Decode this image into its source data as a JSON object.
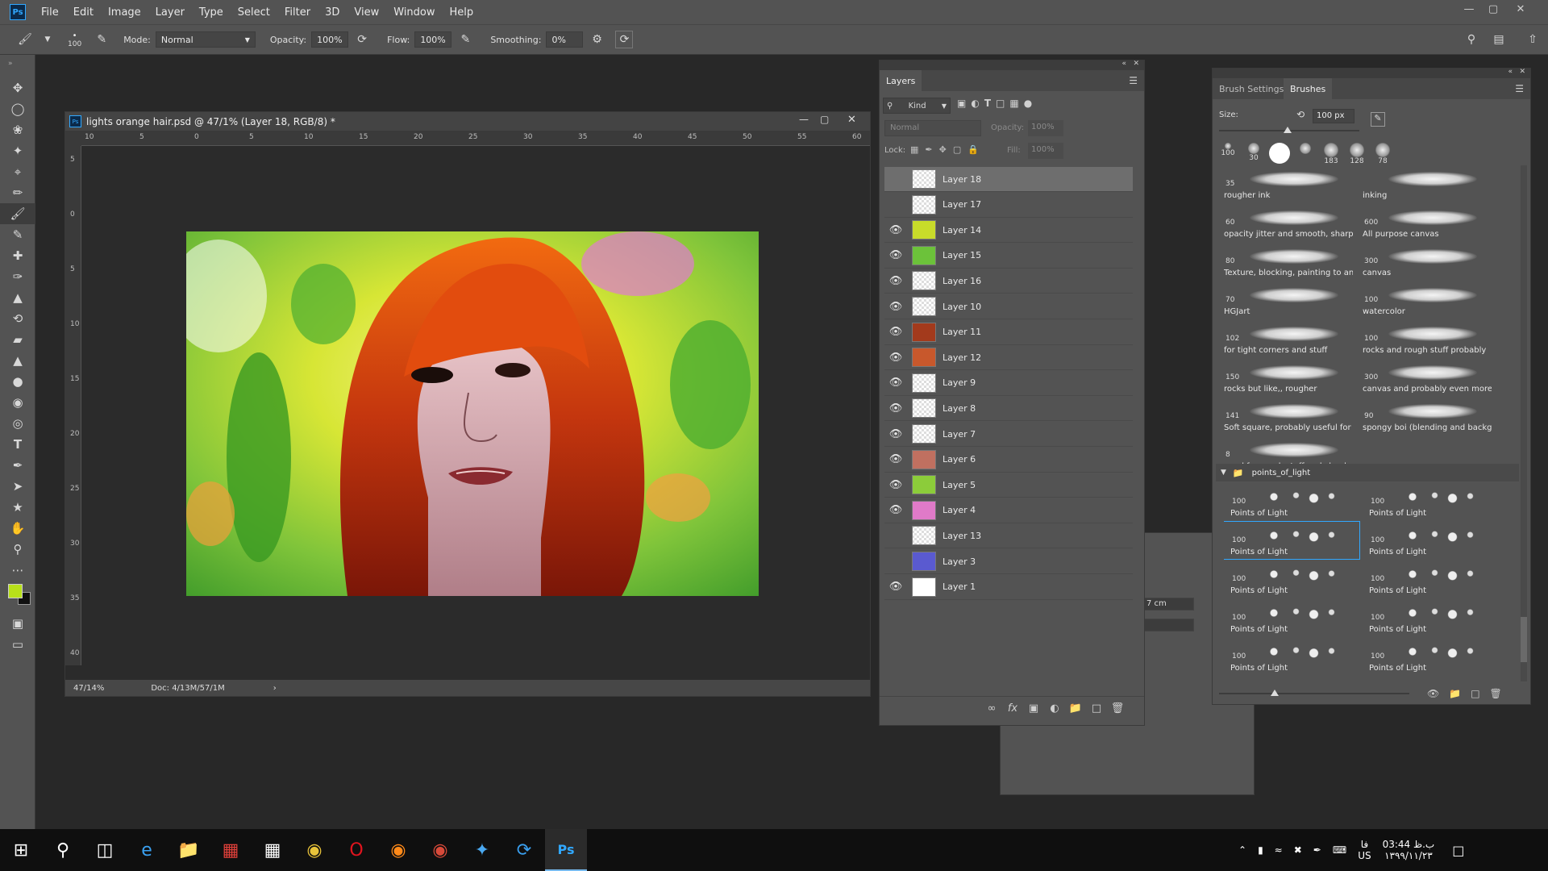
{
  "app": {
    "logo_text": "Ps",
    "menu": [
      "File",
      "Edit",
      "Image",
      "Layer",
      "Type",
      "Select",
      "Filter",
      "3D",
      "View",
      "Window",
      "Help"
    ]
  },
  "options_bar": {
    "brush_size": "100",
    "mode_label": "Mode:",
    "mode_value": "Normal",
    "opacity_label": "Opacity:",
    "opacity_value": "100%",
    "flow_label": "Flow:",
    "flow_value": "100%",
    "smoothing_label": "Smoothing:",
    "smoothing_value": "0%"
  },
  "document": {
    "title": "lights orange hair.psd @ 47/1% (Layer 18, RGB/8) *",
    "ruler_h": [
      "10",
      "5",
      "0",
      "5",
      "10",
      "15",
      "20",
      "25",
      "30",
      "35",
      "40",
      "45",
      "50",
      "55",
      "60"
    ],
    "ruler_v": [
      "5",
      "0",
      "5",
      "10",
      "15",
      "20",
      "25",
      "30",
      "35",
      "40"
    ],
    "zoom": "47/14%",
    "doc_info": "Doc: 4/13M/57/1M",
    "colors": {
      "foreground": "#b8e01a",
      "background": "#111111"
    }
  },
  "layers_panel": {
    "tab_label": "Layers",
    "filter_kind": "Kind",
    "blend_mode": "Normal",
    "opacity_label": "Opacity:",
    "opacity_value": "100%",
    "lock_label": "Lock:",
    "fill_label": "Fill:",
    "fill_value": "100%",
    "layers": [
      {
        "name": "Layer 18",
        "visible": false,
        "selected": true,
        "thumb": "transparent"
      },
      {
        "name": "Layer 17",
        "visible": false,
        "selected": false,
        "thumb": "transparent"
      },
      {
        "name": "Layer 14",
        "visible": true,
        "selected": false,
        "thumb": "#c8dc2a"
      },
      {
        "name": "Layer 15",
        "visible": true,
        "selected": false,
        "thumb": "#6cc23a"
      },
      {
        "name": "Layer 16",
        "visible": true,
        "selected": false,
        "thumb": "transparent"
      },
      {
        "name": "Layer 10",
        "visible": true,
        "selected": false,
        "thumb": "transparent"
      },
      {
        "name": "Layer 11",
        "visible": true,
        "selected": false,
        "thumb": "#a33a1c"
      },
      {
        "name": "Layer 12",
        "visible": true,
        "selected": false,
        "thumb": "#c8582c"
      },
      {
        "name": "Layer 9",
        "visible": true,
        "selected": false,
        "thumb": "transparent"
      },
      {
        "name": "Layer 8",
        "visible": true,
        "selected": false,
        "thumb": "transparent"
      },
      {
        "name": "Layer 7",
        "visible": true,
        "selected": false,
        "thumb": "transparent"
      },
      {
        "name": "Layer 6",
        "visible": true,
        "selected": false,
        "thumb": "#c07060"
      },
      {
        "name": "Layer 5",
        "visible": true,
        "selected": false,
        "thumb": "#8ccc3a"
      },
      {
        "name": "Layer 4",
        "visible": true,
        "selected": false,
        "thumb": "#e07ac8"
      },
      {
        "name": "Layer 13",
        "visible": false,
        "selected": false,
        "thumb": "transparent"
      },
      {
        "name": "Layer 3",
        "visible": false,
        "selected": false,
        "thumb": "#5a5ad0"
      },
      {
        "name": "Layer 1",
        "visible": true,
        "selected": false,
        "thumb": "#ffffff"
      }
    ]
  },
  "brushes_panel": {
    "tabs": [
      "Brush Settings",
      "Brushes"
    ],
    "size_label": "Size:",
    "size_value": "100 px",
    "presets": [
      "100",
      "30",
      "",
      "",
      "183",
      "128",
      "78"
    ],
    "brushes": [
      {
        "size": "35",
        "name": "rougher ink"
      },
      {
        "size": "",
        "name": "inking"
      },
      {
        "size": "60",
        "name": "opacity jitter and smooth, sharp i..."
      },
      {
        "size": "600",
        "name": "All purpose canvas"
      },
      {
        "size": "80",
        "name": "Texture, blocking, painting to an..."
      },
      {
        "size": "300",
        "name": "canvas"
      },
      {
        "size": "70",
        "name": "HGJart"
      },
      {
        "size": "100",
        "name": "watercolor"
      },
      {
        "size": "102",
        "name": "for tight corners and stuff"
      },
      {
        "size": "100",
        "name": "rocks and rough stuff probably"
      },
      {
        "size": "150",
        "name": "rocks but like,, rougher"
      },
      {
        "size": "300",
        "name": "canvas and probably even more r..."
      },
      {
        "size": "141",
        "name": "Soft square, probably useful for c..."
      },
      {
        "size": "90",
        "name": "spongy boi (blending and backgr..."
      },
      {
        "size": "8",
        "name": "good for rough stuff and clouds"
      }
    ],
    "group_name": "points_of_light",
    "points": [
      {
        "size": "100",
        "name": "Points of Light"
      },
      {
        "size": "100",
        "name": "Points of Light"
      },
      {
        "size": "100",
        "name": "Points of Light"
      },
      {
        "size": "100",
        "name": "Points of Light"
      },
      {
        "size": "100",
        "name": "Points of Light"
      },
      {
        "size": "100",
        "name": "Points of Light"
      },
      {
        "size": "100",
        "name": "Points of Light"
      },
      {
        "size": "100",
        "name": "Points of Light"
      },
      {
        "size": "100",
        "name": "Points of Light"
      },
      {
        "size": "100",
        "name": "Points of Light"
      }
    ]
  },
  "behind_panel": {
    "value": "7 cm"
  },
  "taskbar": {
    "time": "03:44 ب.ظ",
    "date": "۱۳۹۹/۱۱/۲۳",
    "lang_top": "فا",
    "lang_bottom": "US"
  }
}
